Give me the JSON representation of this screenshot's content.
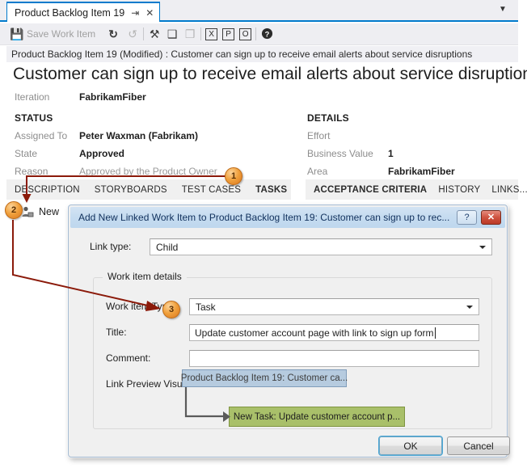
{
  "window": {
    "tab": {
      "title": "Product Backlog Item 19",
      "pin_glyph": "⇥",
      "close_glyph": "✕"
    },
    "overflow_glyph": "▼",
    "toolbar": {
      "save_label": "Save Work Item",
      "save_icon": "floppy-disk",
      "items": [
        {
          "name": "refresh",
          "glyph": "↻"
        },
        {
          "name": "undo",
          "glyph": "↺"
        },
        {
          "name": "link-to-existing",
          "glyph": "⚒"
        },
        {
          "name": "copy-work-item",
          "glyph": "❑"
        },
        {
          "name": "create-copy",
          "glyph": "❒"
        },
        {
          "name": "open-in-excel",
          "glyph": "X"
        },
        {
          "name": "open-in-project",
          "glyph": "P"
        },
        {
          "name": "open-in-office",
          "glyph": "O"
        },
        {
          "name": "help",
          "glyph": "?"
        }
      ]
    },
    "infobar": "Product Backlog Item 19 (Modified) : Customer can sign up to receive email alerts about service disruptions",
    "work_item": {
      "title": "Customer can sign up to receive email alerts about service disruptions",
      "iteration_label": "Iteration",
      "iteration_value": "FabrikamFiber",
      "status_heading": "STATUS",
      "status_fields": [
        {
          "label": "Assigned To",
          "value": "Peter Waxman (Fabrikam)",
          "muted": false
        },
        {
          "label": "State",
          "value": "Approved",
          "muted": false
        },
        {
          "label": "Reason",
          "value": "Approved by the Product Owner",
          "muted": true
        }
      ],
      "details_heading": "DETAILS",
      "details_fields": [
        {
          "label": "Effort",
          "value": "",
          "muted": true
        },
        {
          "label": "Business Value",
          "value": "1",
          "muted": false
        },
        {
          "label": "Area",
          "value": "FabrikamFiber",
          "muted": false
        }
      ],
      "tabs_left": [
        {
          "label": "DESCRIPTION",
          "active": false
        },
        {
          "label": "STORYBOARDS",
          "active": false
        },
        {
          "label": "TEST CASES",
          "active": false
        },
        {
          "label": "TASKS",
          "active": true
        }
      ],
      "tabs_right": [
        {
          "label": "ACCEPTANCE CRITERIA",
          "active": true
        },
        {
          "label": "HISTORY",
          "active": false
        },
        {
          "label": "LINKS...",
          "active": false
        }
      ],
      "new_button_label": "New"
    }
  },
  "dialog": {
    "title": "Add New Linked Work Item to Product Backlog Item 19: Customer can sign up to rec...",
    "help_glyph": "?",
    "close_glyph": "✕",
    "link_type_label": "Link type:",
    "link_type_value": "Child",
    "groupbox_legend": "Work item details",
    "work_item_type_label": "Work item Type:",
    "work_item_type_value": "Task",
    "title_label": "Title:",
    "title_value": "Update customer account page with link to sign up form",
    "comment_label": "Comment:",
    "comment_value": "",
    "preview_label": "Link Preview Visualization:",
    "preview": {
      "parent_node": "Product Backlog Item 19: Customer ca...",
      "child_node": "New Task: Update customer account p..."
    },
    "ok_label": "OK",
    "cancel_label": "Cancel"
  },
  "callouts": [
    {
      "number": "1"
    },
    {
      "number": "2"
    },
    {
      "number": "3"
    }
  ],
  "colors": {
    "accent_blue": "#007acc",
    "callout_orange": "#f0a03c",
    "arrow_red": "#8b1a0a",
    "node_parent": "#b6cbdf",
    "node_child": "#a9c06a"
  }
}
